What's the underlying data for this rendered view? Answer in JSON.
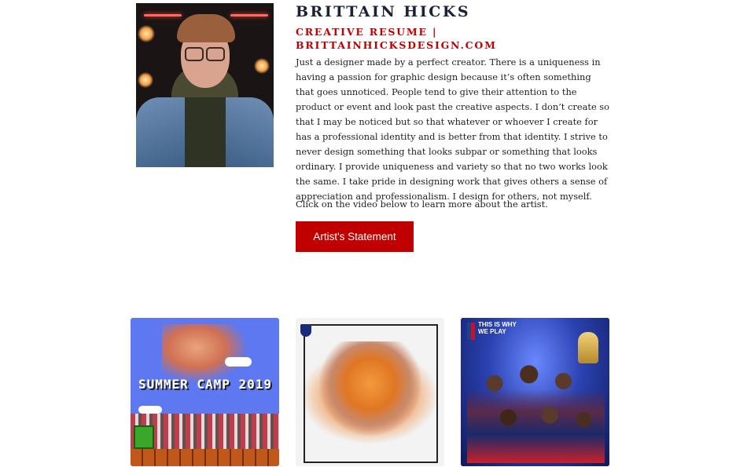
{
  "profile": {
    "name": "BRITTAIN HICKS",
    "subtitle": "CREATIVE RESUME | BRITTAINHICKSDESIGN.COM",
    "bio": "Just a designer made by a perfect creator. There is a uniqueness in having a passion for graphic design because it’s often something that goes unnoticed. People tend to give their attention to the product or event and look past the creative aspects. I don’t create so that I may be noticed but so that whatever or whoever I create for has a professional identity and is better from that identity. I strive to never design something that looks subpar or something that looks ordinary. I provide uniqueness and variety so that no two works look the same. I take pride in designing work that gives others a sense of appreciation and professionalism. I design for others, not myself.",
    "cta_text": "Click on the video below to learn more about the artist.",
    "button_label": "Artist's Statement"
  },
  "portfolio": {
    "tile1_text": "SUMMER CAMP 2019",
    "tile3_text": "THIS IS WHY WE PLAY"
  },
  "colors": {
    "accent": "#c00000",
    "name": "#1b2235"
  }
}
